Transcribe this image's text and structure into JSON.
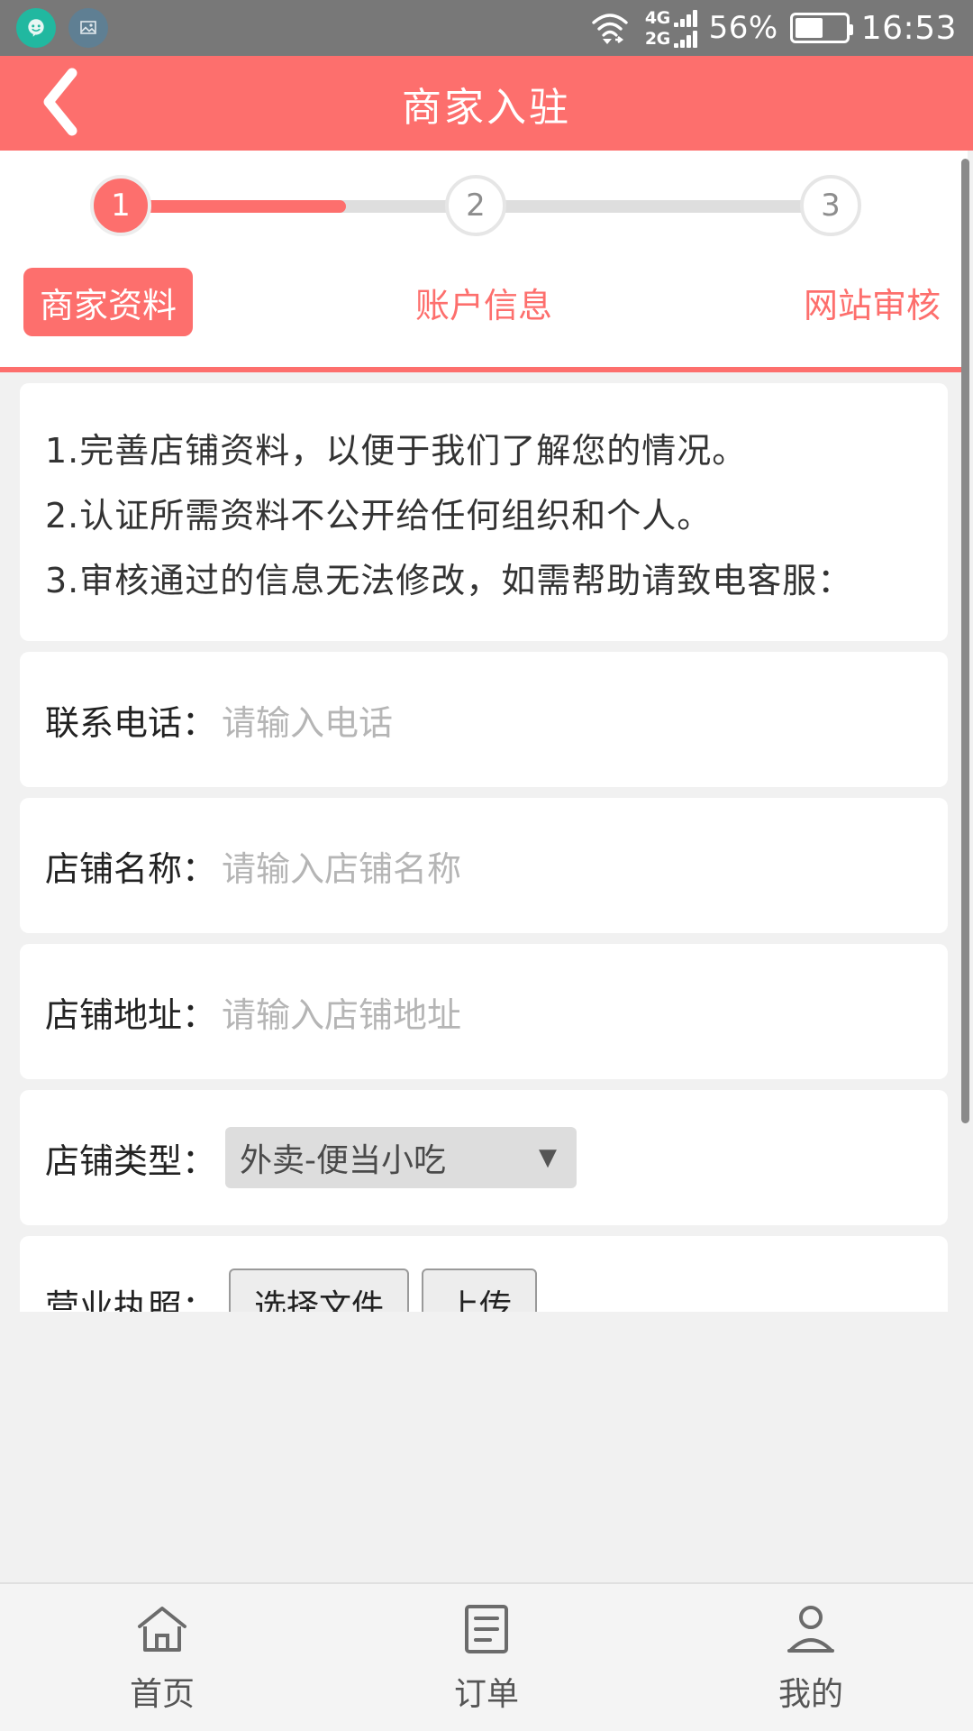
{
  "statusbar": {
    "left_icons": [
      {
        "name": "chat-bubble-icon",
        "glyph": "☺"
      },
      {
        "name": "screenshot-icon",
        "glyph": "▣"
      }
    ],
    "wifi_icon": "wifi-icon",
    "signal_rows": [
      {
        "label": "4G",
        "bars": 4
      },
      {
        "label": "2G",
        "bars": 4
      }
    ],
    "battery_percent": "56%",
    "battery_icon": "battery-icon",
    "time": "16:53"
  },
  "header": {
    "back_icon": "back-chevron-icon",
    "title": "商家入驻",
    "bg_color": "#fd6f6d"
  },
  "stepper": {
    "steps": [
      {
        "number": "1",
        "state": "active"
      },
      {
        "number": "2",
        "state": "inactive"
      },
      {
        "number": "3",
        "state": "inactive"
      }
    ],
    "progress_percent": 32,
    "accent_color": "#fd6f6d",
    "track_color": "#dedede"
  },
  "tabs": [
    {
      "label": "商家资料",
      "active": true
    },
    {
      "label": "账户信息",
      "active": false
    },
    {
      "label": "网站审核",
      "active": false
    }
  ],
  "notice": {
    "lines": [
      "1.完善店铺资料，以便于我们了解您的情况。",
      "2.认证所需资料不公开给任何组织和个人。",
      "3.审核通过的信息无法修改，如需帮助请致电客服："
    ]
  },
  "form": {
    "phone": {
      "label": "联系电话：",
      "placeholder": "请输入电话",
      "value": ""
    },
    "shop_name": {
      "label": "店铺名称：",
      "placeholder": "请输入店铺名称",
      "value": ""
    },
    "shop_address": {
      "label": "店铺地址：",
      "placeholder": "请输入店铺地址",
      "value": ""
    },
    "shop_type": {
      "label": "店铺类型：",
      "selected": "外卖-便当小吃",
      "caret_icon": "chevron-down-icon"
    },
    "license": {
      "label": "营业执照：",
      "choose_label": "选择文件",
      "upload_label": "上传"
    }
  },
  "bottomnav": [
    {
      "label": "首页",
      "icon": "home-icon"
    },
    {
      "label": "订单",
      "icon": "list-icon"
    },
    {
      "label": "我的",
      "icon": "person-icon"
    }
  ]
}
